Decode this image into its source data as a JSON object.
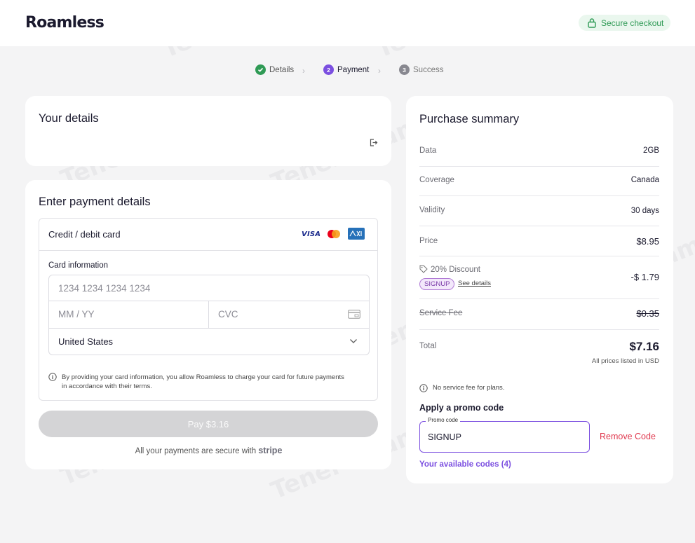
{
  "header": {
    "logo_text": "Roamless",
    "secure_label": "Secure checkout"
  },
  "steps": [
    {
      "num": "1",
      "label": "Details",
      "status": "done"
    },
    {
      "num": "2",
      "label": "Payment",
      "status": "active"
    },
    {
      "num": "3",
      "label": "Success",
      "status": "pending"
    }
  ],
  "your_details": {
    "title": "Your details"
  },
  "payment": {
    "title": "Enter payment details",
    "method_label": "Credit / debit card",
    "card_brands": [
      "VISA",
      "mastercard",
      "amex"
    ],
    "card_info_label": "Card information",
    "card_number_placeholder": "1234 1234 1234 1234",
    "expiry_placeholder": "MM / YY",
    "cvc_placeholder": "CVC",
    "country_value": "United States",
    "notice": "By providing your card information, you allow Roamless to charge your card for future payments in accordance with their terms.",
    "pay_button": "Pay $3.16",
    "secure_note": "All your payments are secure with",
    "stripe": "stripe"
  },
  "summary": {
    "title": "Purchase summary",
    "rows": [
      {
        "label": "Data",
        "value": "2GB"
      },
      {
        "label": "Coverage",
        "value": "Canada"
      },
      {
        "label": "Validity",
        "value": "30 days"
      },
      {
        "label": "Price",
        "value": "$8.95"
      }
    ],
    "discount": {
      "label": "20% Discount",
      "code": "SIGNUP",
      "see_details": "See details",
      "value": "-$ 1.79"
    },
    "service_fee": {
      "label": "Service Fee",
      "value": "$0.35"
    },
    "total": {
      "label": "Total",
      "value": "$7.16",
      "note": "All prices listed in USD"
    },
    "no_fee_note": "No service fee for plans.",
    "promo_title": "Apply a promo code",
    "promo_legend": "Promo code",
    "promo_value": "SIGNUP",
    "remove_code": "Remove Code",
    "available_codes": "Your available codes (4)"
  },
  "watermark": "Tenereteam",
  "colors": {
    "accent": "#7b4fe0",
    "success": "#2f9a55",
    "danger": "#e0394f",
    "pill_bg": "#f3e8fb"
  }
}
